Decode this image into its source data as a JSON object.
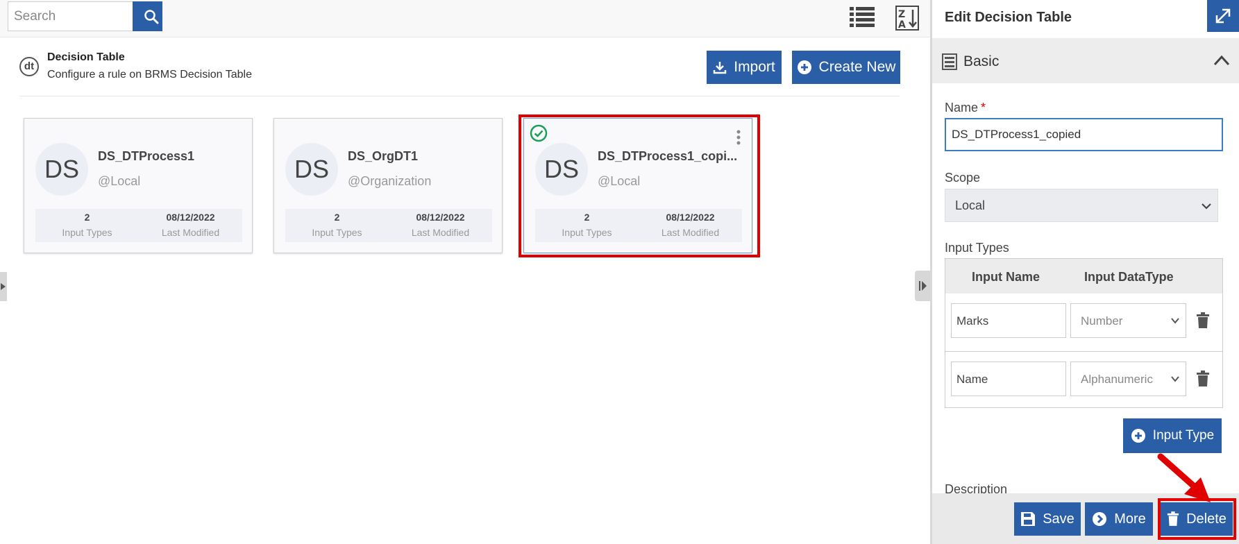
{
  "toolbar": {
    "search_placeholder": "Search",
    "search_icon": "magnifier-icon",
    "list_view_icon": "list-view-icon",
    "sort_icon": "sort-az-icon"
  },
  "header": {
    "icon_text": "dt",
    "title": "Decision Table",
    "subtitle": "Configure a rule on BRMS Decision Table",
    "import_label": "Import",
    "create_label": "Create New"
  },
  "cards": [
    {
      "avatar": "DS",
      "name": "DS_DTProcess1",
      "scope": "@Local",
      "input_types": "2",
      "input_types_label": "Input Types",
      "modified": "08/12/2022",
      "modified_label": "Last Modified"
    },
    {
      "avatar": "DS",
      "name": "DS_OrgDT1",
      "scope": "@Organization",
      "input_types": "2",
      "input_types_label": "Input Types",
      "modified": "08/12/2022",
      "modified_label": "Last Modified"
    },
    {
      "avatar": "DS",
      "name": "DS_DTProcess1_copi...",
      "scope": "@Local",
      "input_types": "2",
      "input_types_label": "Input Types",
      "modified": "08/12/2022",
      "modified_label": "Last Modified",
      "selected": true
    }
  ],
  "panel": {
    "title": "Edit Decision Table",
    "section": "Basic",
    "name_label": "Name",
    "required_mark": "*",
    "name_value": "DS_DTProcess1_copied",
    "scope_label": "Scope",
    "scope_value": "Local",
    "input_types_label": "Input Types",
    "col_name": "Input Name",
    "col_type": "Input DataType",
    "rows": [
      {
        "name": "Marks",
        "type": "Number"
      },
      {
        "name": "Name",
        "type": "Alphanumeric"
      }
    ],
    "add_input_type_label": "Input Type",
    "description_label": "Description",
    "save_label": "Save",
    "more_label": "More",
    "delete_label": "Delete"
  },
  "colors": {
    "primary": "#2a5fa8",
    "highlight": "#e00000",
    "success": "#1a9e5a"
  }
}
